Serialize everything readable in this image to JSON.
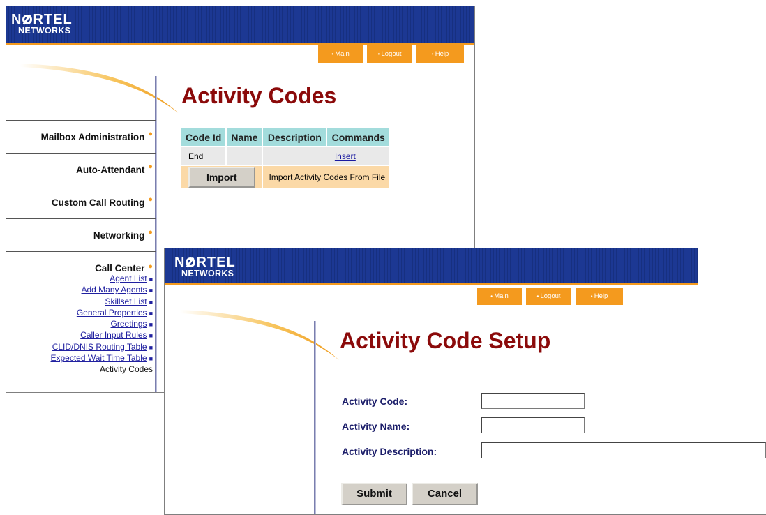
{
  "brand": {
    "line1a": "N",
    "line1b": "RTEL",
    "line2": "NETWORKS"
  },
  "nav": {
    "main": "Main",
    "logout": "Logout",
    "help": "Help"
  },
  "window1": {
    "title": "Activity Codes",
    "sidebar": {
      "items": [
        {
          "label": "Mailbox Administration"
        },
        {
          "label": "Auto-Attendant"
        },
        {
          "label": "Custom Call Routing"
        },
        {
          "label": "Networking"
        }
      ],
      "call_center": {
        "label": "Call Center",
        "links": [
          "Agent List",
          "Add Many Agents",
          "Skillset List",
          "General Properties",
          "Greetings",
          "Caller Input Rules",
          "CLID/DNIS Routing Table",
          "Expected Wait Time Table"
        ],
        "current": "Activity Codes"
      }
    },
    "table": {
      "headers": [
        "Code Id",
        "Name",
        "Description",
        "Commands"
      ],
      "end_row": {
        "code_id": "End",
        "name": "",
        "description": "",
        "command": "Insert"
      },
      "import_row": {
        "button": "Import",
        "text": "Import Activity Codes From File"
      }
    }
  },
  "window2": {
    "title": "Activity Code Setup",
    "form": {
      "code_label": "Activity Code:",
      "code_value": "",
      "name_label": "Activity Name:",
      "name_value": "",
      "desc_label": "Activity Description:",
      "desc_value": "",
      "submit": "Submit",
      "cancel": "Cancel"
    }
  },
  "colors": {
    "banner": "#1a3590",
    "accent_orange": "#f49a1e",
    "title_red": "#8b0a0a",
    "table_header": "#a3dcdc",
    "import_row": "#fbd9a7"
  }
}
